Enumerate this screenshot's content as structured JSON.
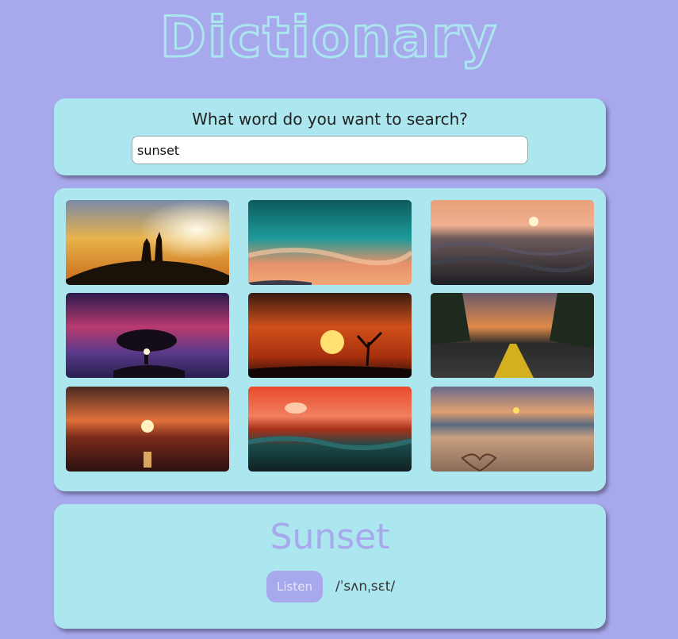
{
  "header": {
    "title": "Dictionary"
  },
  "search": {
    "prompt": "What word do you want to search?",
    "value": "sunset"
  },
  "gallery": {
    "photos": [
      {
        "icon": "couple-silhouette-sunset-photo"
      },
      {
        "icon": "teal-sky-clouds-photo"
      },
      {
        "icon": "ocean-waves-sunset-photo"
      },
      {
        "icon": "tree-purple-sky-photo"
      },
      {
        "icon": "orange-sun-tree-photo"
      },
      {
        "icon": "palm-road-sunset-photo"
      },
      {
        "icon": "sea-horizon-sunset-photo"
      },
      {
        "icon": "red-ocean-waves-photo"
      },
      {
        "icon": "beach-heart-sunset-photo"
      }
    ]
  },
  "result": {
    "word": "Sunset",
    "listen_label": "Listen",
    "phonetic": "/ˈsʌnˌsɛt/"
  },
  "colors": {
    "background": "#a8a8ec",
    "card": "#ace6ef",
    "accent": "#a8a8ec"
  }
}
